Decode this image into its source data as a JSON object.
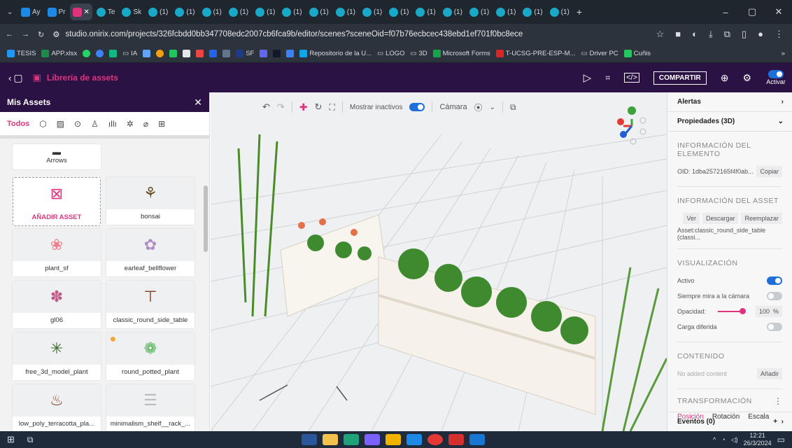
{
  "browser": {
    "tabs": [
      "Ay",
      "Pr",
      "",
      "Te",
      "Sk",
      "(1)",
      "(1)",
      "(1)",
      "(1)",
      "(1)",
      "(1)",
      "(1)",
      "(1)",
      "(1)",
      "(1)",
      "(1)",
      "(1)",
      "(1)",
      "(1)",
      "(1)",
      "(1)"
    ],
    "new_tab": "+",
    "url": "studio.onirix.com/projects/326fcbdd0bb347708edc2007cb6fca9b/editor/scenes?sceneOid=f07b76ecbcec438ebd1ef701f0bc8ece",
    "bookmarks": [
      "TESIS",
      "APP.xlsx",
      "IA",
      "SF",
      "Repositorio de la U...",
      "LOGO",
      "3D",
      "Microsoft Forms",
      "T-UCSG-PRE-ESP-M...",
      "Driver PC",
      "Cuñis"
    ],
    "bookmarks_more": "»"
  },
  "app": {
    "title": "Librería de assets",
    "share_label": "COMPARTIR",
    "activate_label": "Activar"
  },
  "left_panel": {
    "title": "Mis Assets",
    "filter_all": "Todos",
    "folder": "Arrows",
    "assets": [
      "AÑADIR ASSET",
      "bonsai",
      "plant_sf",
      "earleaf_bellflower",
      "gl06",
      "classic_round_side_table",
      "free_3d_model_plant",
      "round_potted_plant",
      "low_poly_terracotta_pla...",
      "minimalism_shelf__rack_..."
    ]
  },
  "viewport": {
    "show_inactive": "Mostrar inactivos",
    "camera": "Cámara"
  },
  "right_panel": {
    "alerts": "Alertas",
    "properties": "Propiedades (3D)",
    "element_info": "INFORMACIÓN DEL ELEMENTO",
    "oid": "OID: 1dba2572165f4f0ab...",
    "copy": "Copiar",
    "asset_info": "INFORMACIÓN DEL ASSET",
    "view": "Ver",
    "download": "Descargar",
    "replace": "Reemplazar",
    "asset_name": "Asset:classic_round_side_table (classi...",
    "visualization": "VISUALIZACIÓN",
    "active": "Activo",
    "always_look": "Siempre mira a la cámara",
    "opacity": "Opacidad:",
    "opacity_value": "100",
    "opacity_unit": "%",
    "lazy_load": "Carga diferida",
    "content": "CONTENIDO",
    "no_content": "No added content",
    "add": "Añadir",
    "transform": "TRANSFORMACIÓN",
    "position": "Posición",
    "rotation": "Rotación",
    "scale": "Escala",
    "events": "Eventos (0)"
  },
  "taskbar": {
    "time": "12:21",
    "date": "26/3/2024"
  },
  "colors": {
    "brand_pink": "#e0337e",
    "header_purple": "#2a1244",
    "toggle_blue": "#1e6fd9"
  }
}
